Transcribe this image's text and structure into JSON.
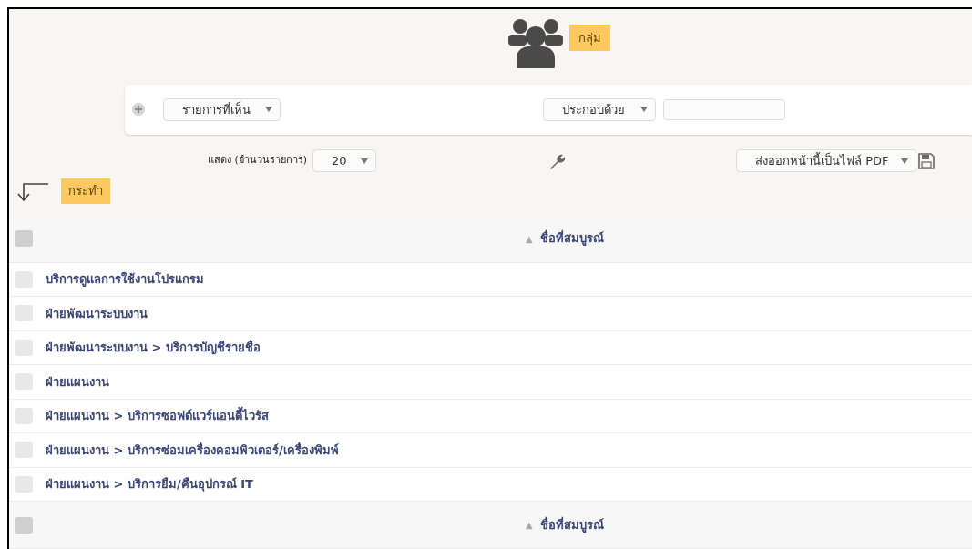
{
  "header": {
    "title": "กลุ่ม"
  },
  "filter": {
    "field_select": "รายการที่เห็น",
    "operator_select": "ประกอบด้วย"
  },
  "toolbar": {
    "show_label": "แสดง (จำนวนรายการ)",
    "page_size": "20",
    "export_select": "ส่งออกหน้านี้เป็นไฟล์ PDF"
  },
  "action_button": "กระทำ",
  "table": {
    "header": {
      "sort_mark": "▲",
      "column": "ชื่อที่สมบูรณ์",
      "checked": false
    },
    "rows": [
      {
        "name": "บริการดูแลการใช้งานโปรแกรม",
        "checked": false
      },
      {
        "name": "ฝ่ายพัฒนาระบบงาน",
        "checked": false
      },
      {
        "name": "ฝ่ายพัฒนาระบบงาน > บริการบัญชีรายชื่อ",
        "checked": false
      },
      {
        "name": "ฝ่ายแผนงาน",
        "checked": false
      },
      {
        "name": "ฝ่ายแผนงาน > บริการซอฟต์แวร์แอนตี้ไวรัส",
        "checked": false
      },
      {
        "name": "ฝ่ายแผนงาน > บริการซ่อมเครื่องคอมพิวเตอร์/เครื่องพิมพ์",
        "checked": false
      },
      {
        "name": "ฝ่ายแผนงาน > บริการยืม/คืนอุปกรณ์ IT",
        "checked": false
      }
    ],
    "footer": {
      "sort_mark": "▲",
      "column": "ชื่อที่สมบูรณ์",
      "checked": false
    }
  }
}
